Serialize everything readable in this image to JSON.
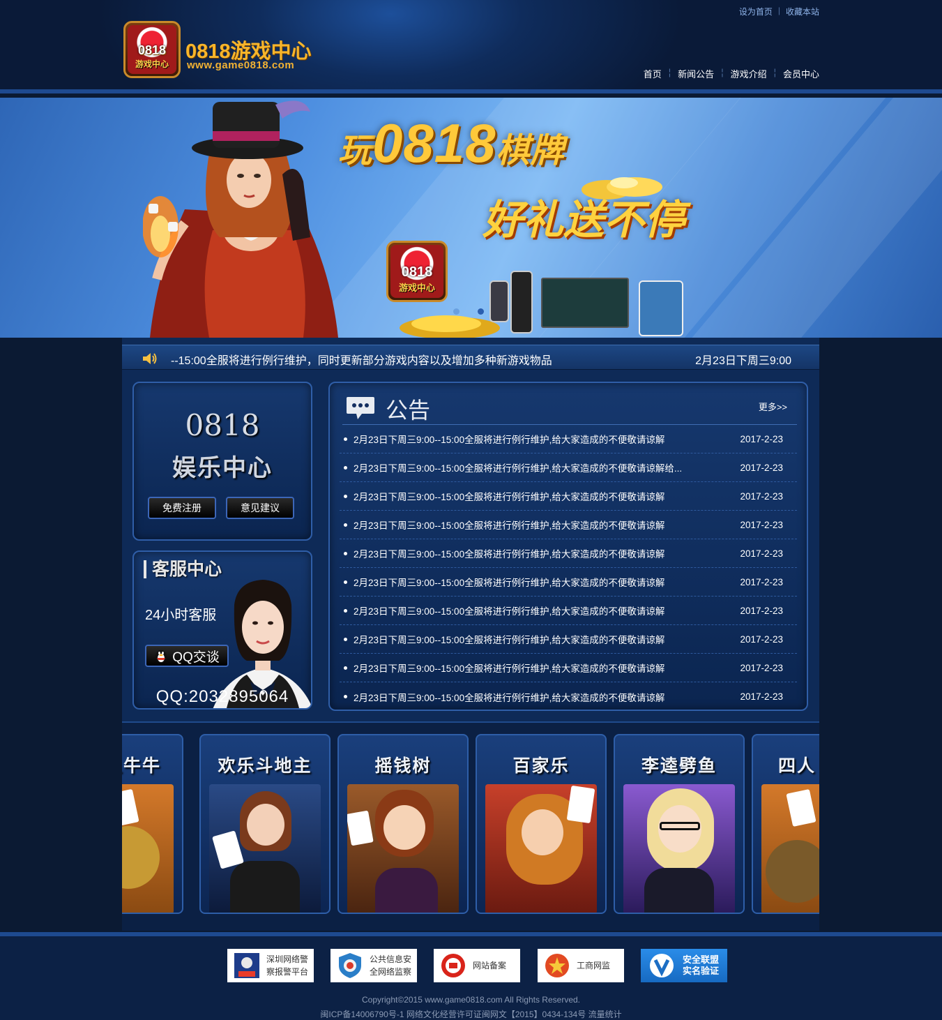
{
  "header": {
    "logo_line1": "0818",
    "logo_line2": "游戏中心",
    "brand_title": "0818游戏中心",
    "brand_url": "www.game0818.com",
    "top_links": [
      "设为首页",
      "收藏本站"
    ],
    "nav": [
      "首页",
      "新闻公告",
      "游戏介绍",
      "会员中心"
    ]
  },
  "banner": {
    "line1_prefix": "玩",
    "line1_main": "0818",
    "line1_suffix": "棋牌",
    "line2": "好礼送不停",
    "logo_line1": "0818",
    "logo_line2": "游戏中心",
    "active_slide": 2
  },
  "ticker": {
    "message": "--15:00全服将进行例行维护，同时更新部分游戏内容以及增加多种新游戏物品",
    "time": "2月23日下周三9:00"
  },
  "entertainment": {
    "title1": "0818",
    "title2": "娱乐中心",
    "register_label": "免费注册",
    "feedback_label": "意见建议"
  },
  "customer_service": {
    "title": "客服中心",
    "hours": "24小时客服",
    "qq_button": "QQ交谈",
    "qq_number": "QQ:2032895064"
  },
  "news": {
    "title": "公告",
    "more": "更多>>",
    "items": [
      {
        "text": "2月23日下周三9:00--15:00全服将进行例行维护,给大家造成的不便敬请谅解",
        "date": "2017-2-23"
      },
      {
        "text": "2月23日下周三9:00--15:00全服将进行例行维护,给大家造成的不便敬请谅解给...",
        "date": "2017-2-23"
      },
      {
        "text": "2月23日下周三9:00--15:00全服将进行例行维护,给大家造成的不便敬请谅解",
        "date": "2017-2-23"
      },
      {
        "text": "2月23日下周三9:00--15:00全服将进行例行维护,给大家造成的不便敬请谅解",
        "date": "2017-2-23"
      },
      {
        "text": "2月23日下周三9:00--15:00全服将进行例行维护,给大家造成的不便敬请谅解",
        "date": "2017-2-23"
      },
      {
        "text": "2月23日下周三9:00--15:00全服将进行例行维护,给大家造成的不便敬请谅解",
        "date": "2017-2-23"
      },
      {
        "text": "2月23日下周三9:00--15:00全服将进行例行维护,给大家造成的不便敬请谅解",
        "date": "2017-2-23"
      },
      {
        "text": "2月23日下周三9:00--15:00全服将进行例行维护,给大家造成的不便敬请谅解",
        "date": "2017-2-23"
      },
      {
        "text": "2月23日下周三9:00--15:00全服将进行例行维护,给大家造成的不便敬请谅解",
        "date": "2017-2-23"
      },
      {
        "text": "2月23日下周三9:00--15:00全服将进行例行维护,给大家造成的不便敬请谅解",
        "date": "2017-2-23"
      }
    ]
  },
  "games": [
    {
      "name": "人牛牛"
    },
    {
      "name": "欢乐斗地主"
    },
    {
      "name": "摇钱树"
    },
    {
      "name": "百家乐"
    },
    {
      "name": "李逵劈鱼"
    },
    {
      "name": "四人"
    }
  ],
  "footer": {
    "badges": [
      {
        "line1": "深圳网络警",
        "line2": "察报警平台"
      },
      {
        "line1": "公共信息安",
        "line2": "全网络监察"
      },
      {
        "line1": "网站备案",
        "line2": ""
      },
      {
        "line1": "工商网监",
        "line2": ""
      },
      {
        "line1": "安全联盟",
        "line2": "实名验证"
      }
    ],
    "copyright": "Copyright©2015 www.game0818.com All Rights Reserved.",
    "icp": "闽ICP备14006790号-1 网络文化经营许可证闽网文【2015】0434-134号 流量统计"
  },
  "colors": {
    "accent_gold": "#f7b52b",
    "panel_border": "#2f5ea8",
    "bg_dark": "#0b1a33"
  }
}
